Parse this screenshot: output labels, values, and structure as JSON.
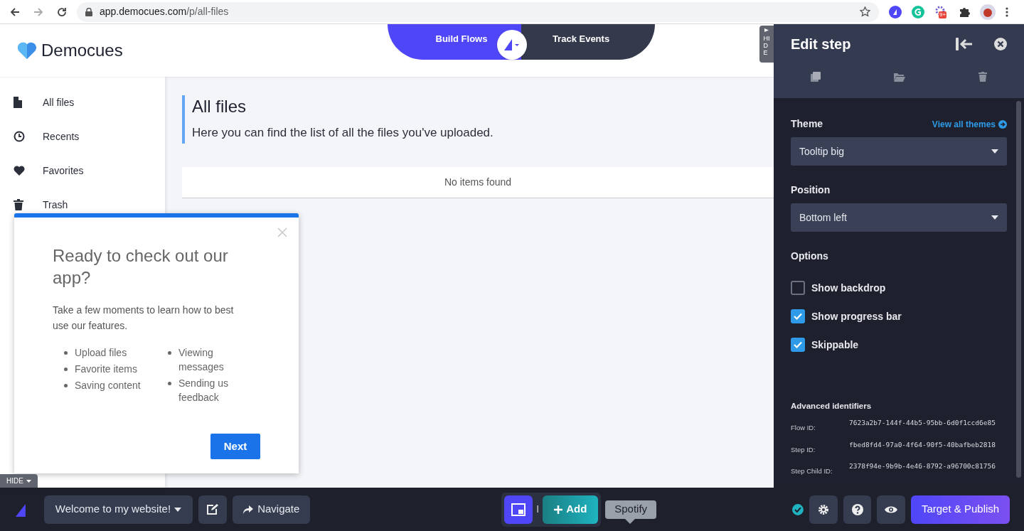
{
  "browser": {
    "url_host": "app.democues.com",
    "url_path": "/p/all-files",
    "extension_badge": "9+"
  },
  "app": {
    "logo": "Democues"
  },
  "mode_tabs": [
    {
      "label": "Build Flows",
      "selected": true
    },
    {
      "label": "Track Events",
      "selected": false
    }
  ],
  "sidebar": {
    "items": [
      {
        "label": "All files"
      },
      {
        "label": "Recents"
      },
      {
        "label": "Favorites"
      },
      {
        "label": "Trash"
      }
    ]
  },
  "page": {
    "title": "All files",
    "subtitle": "Here you can find the list of all the files you've uploaded.",
    "empty_message": "No items found"
  },
  "side_hide_tab": "HIDE",
  "modal": {
    "title": "Ready to check out our app?",
    "body": "Take a few moments to learn how to best use our features.",
    "list_columns": [
      [
        "Upload files",
        "Favorite items",
        "Saving content"
      ],
      [
        "Viewing messages",
        "Sending us feedback"
      ]
    ],
    "button": "Next"
  },
  "edit_panel": {
    "title": "Edit step",
    "theme": {
      "label": "Theme",
      "link": "View all themes",
      "value": "Tooltip big"
    },
    "position": {
      "label": "Position",
      "value": "Bottom left"
    },
    "options_label": "Options",
    "options": [
      {
        "label": "Show backdrop",
        "checked": false
      },
      {
        "label": "Show progress bar",
        "checked": true
      },
      {
        "label": "Skippable",
        "checked": true
      }
    ],
    "advanced": {
      "title": "Advanced identifiers",
      "rows": [
        {
          "label": "Flow ID:",
          "value": "7623a2b7-144f-44b5-95bb-6d0f1ccd6e85"
        },
        {
          "label": "Step ID:",
          "value": "fbed8fd4-97a0-4f64-90f5-40bafbeb2818"
        },
        {
          "label": "Step Child ID:",
          "value": "2378f94e-9b9b-4e46-8792-a96700c81756"
        }
      ]
    }
  },
  "bottom_hide_tab": "HIDE",
  "bottom_bar": {
    "flow_select": "Welcome to my website!",
    "navigate": "Navigate",
    "separator": "I",
    "add": "Add",
    "tooltip": "Spotify",
    "publish": "Target & Publish"
  }
}
